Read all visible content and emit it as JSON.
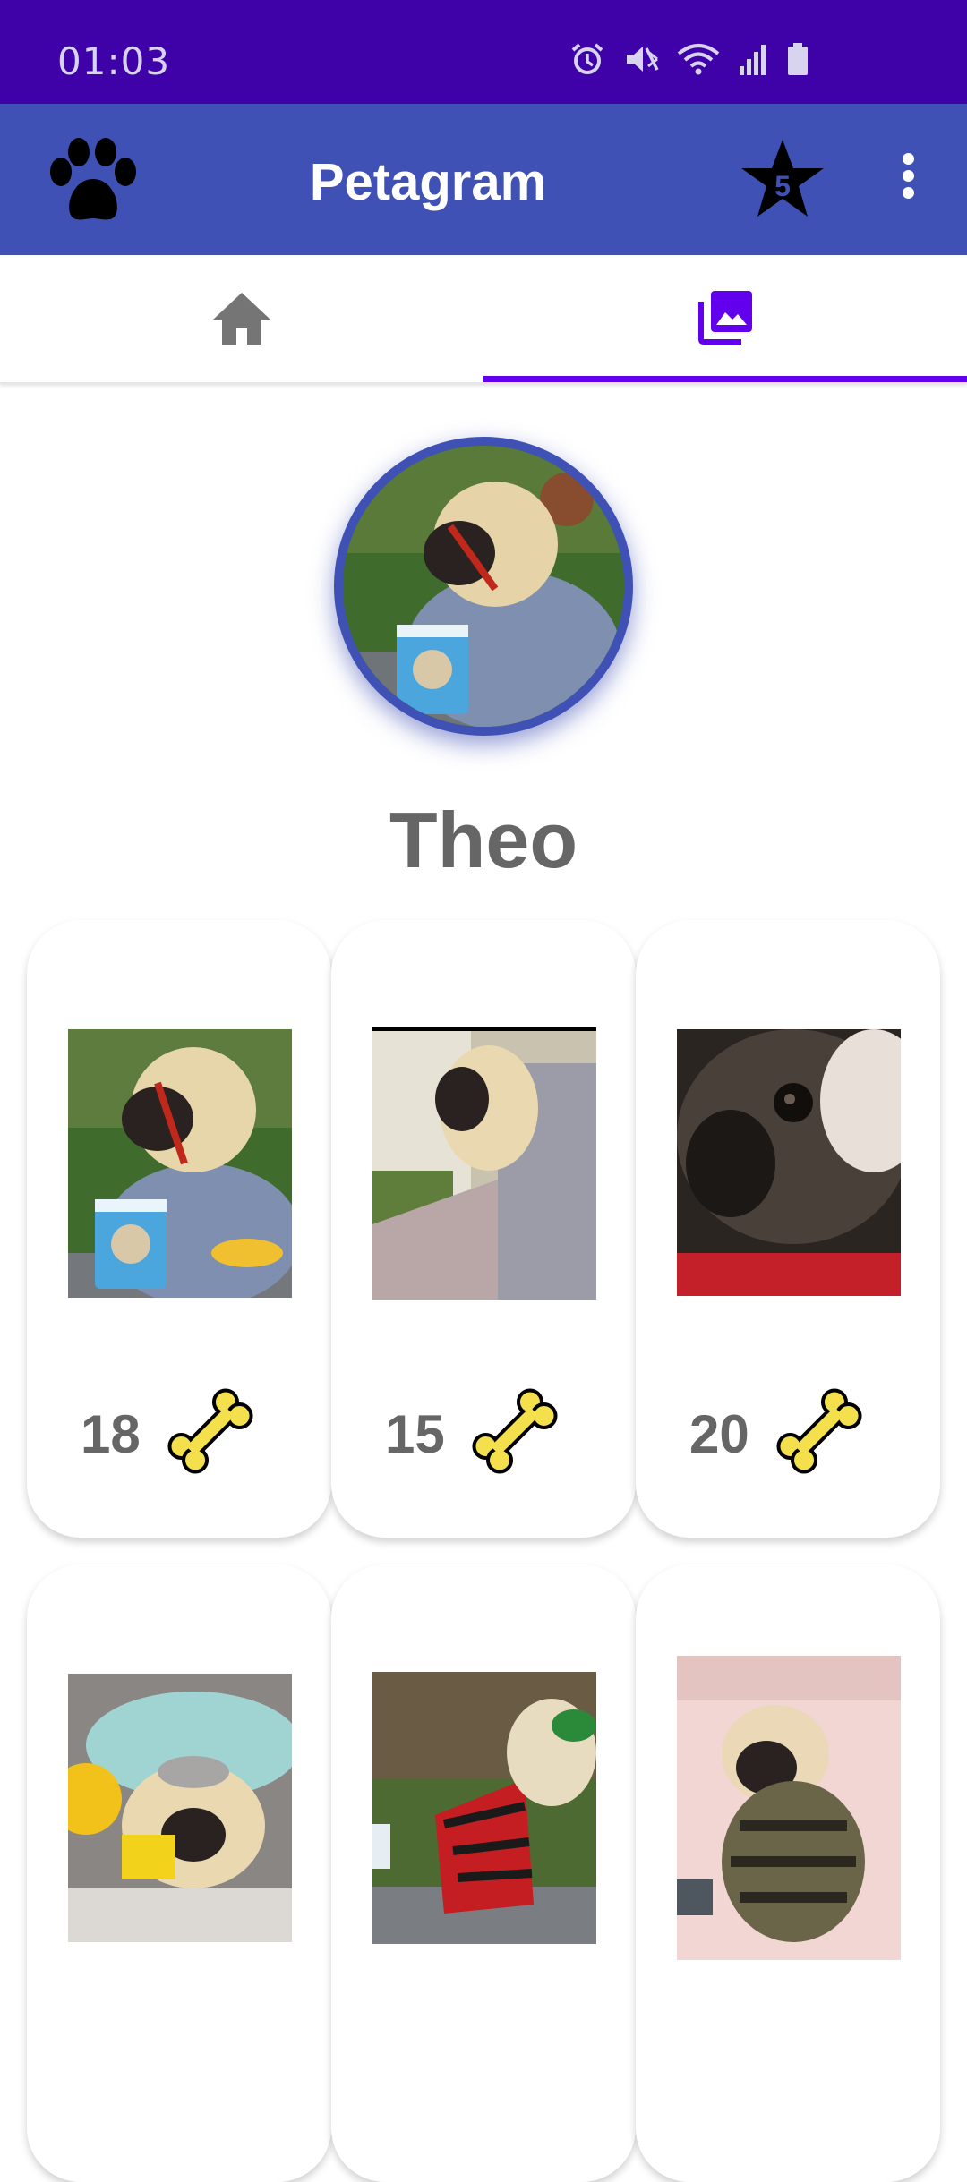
{
  "status_bar": {
    "time": "01:03"
  },
  "app_bar": {
    "title": "Petagram",
    "favorites_count": "5"
  },
  "tabs": [
    {
      "name": "home",
      "icon": "home-icon",
      "selected": false
    },
    {
      "name": "gallery",
      "icon": "photo-library-icon",
      "selected": true
    }
  ],
  "profile": {
    "name": "Theo"
  },
  "photos": [
    {
      "rating": "18"
    },
    {
      "rating": "15"
    },
    {
      "rating": "20"
    },
    {
      "rating": ""
    },
    {
      "rating": ""
    },
    {
      "rating": ""
    }
  ],
  "colors": {
    "status_bar": "#3f01a8",
    "app_bar": "#3f51b5",
    "tab_accent": "#6200ee",
    "bone": "#f4e04d"
  }
}
